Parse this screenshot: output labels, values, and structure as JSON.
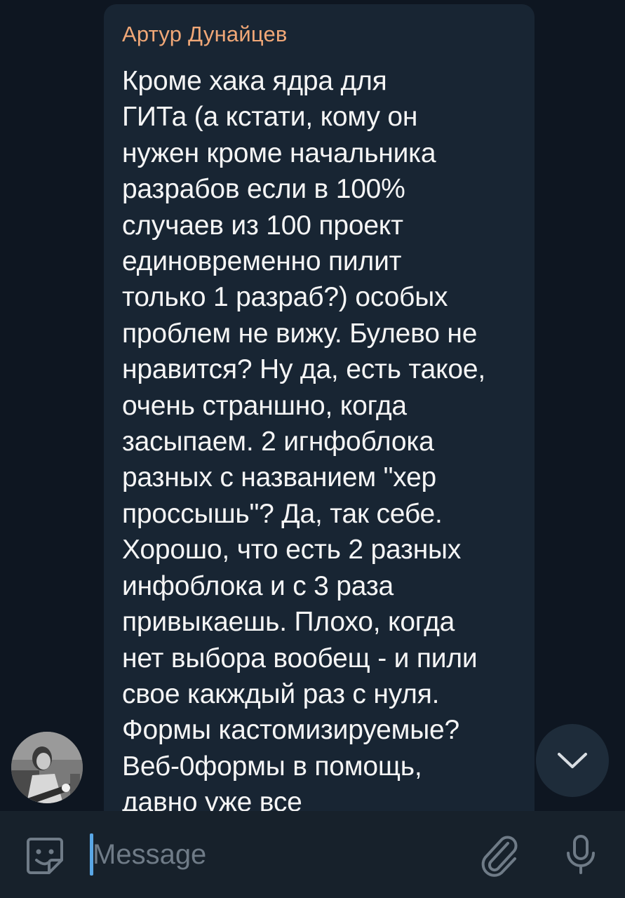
{
  "message": {
    "sender": "Артур Дунайцев",
    "text": "Кроме хака ядра для\nГИТа (а кстати, кому он\nнужен кроме начальника\nразрабов если в 100%\nслучаев из 100 проект\nединовременно пилит\nтолько 1 разраб?) особых\nпроблем не вижу. Булево не\nнравится? Ну да, есть такое,\nочень страншно, когда\nзасыпаем. 2 игнфоблока\nразных с названием \"хер\nпроссышь\"? Да, так себе.\nХорошо, что есть 2 разных\nинфоблока и с 3 раза\nпривыкаешь. Плохо, когда\nнет выбора вообещ - и пили\nсвое какждый раз с нуля.\nФормы кастомизируемые?\nВеб-0формы в помощь,\nдавно уже все\nшаблрнизировано, просто"
  },
  "composer": {
    "placeholder": "Message"
  },
  "icons": {
    "sticker": "sticker-smile-icon",
    "attach": "paperclip-icon",
    "mic": "microphone-icon",
    "scroll_down": "chevron-down-icon"
  },
  "colors": {
    "background": "#0e1621",
    "bubble": "#182533",
    "sender_name": "#f0a777",
    "input_bar": "#17212b",
    "cursor": "#5aa7e6",
    "icon": "#6f7b87"
  }
}
